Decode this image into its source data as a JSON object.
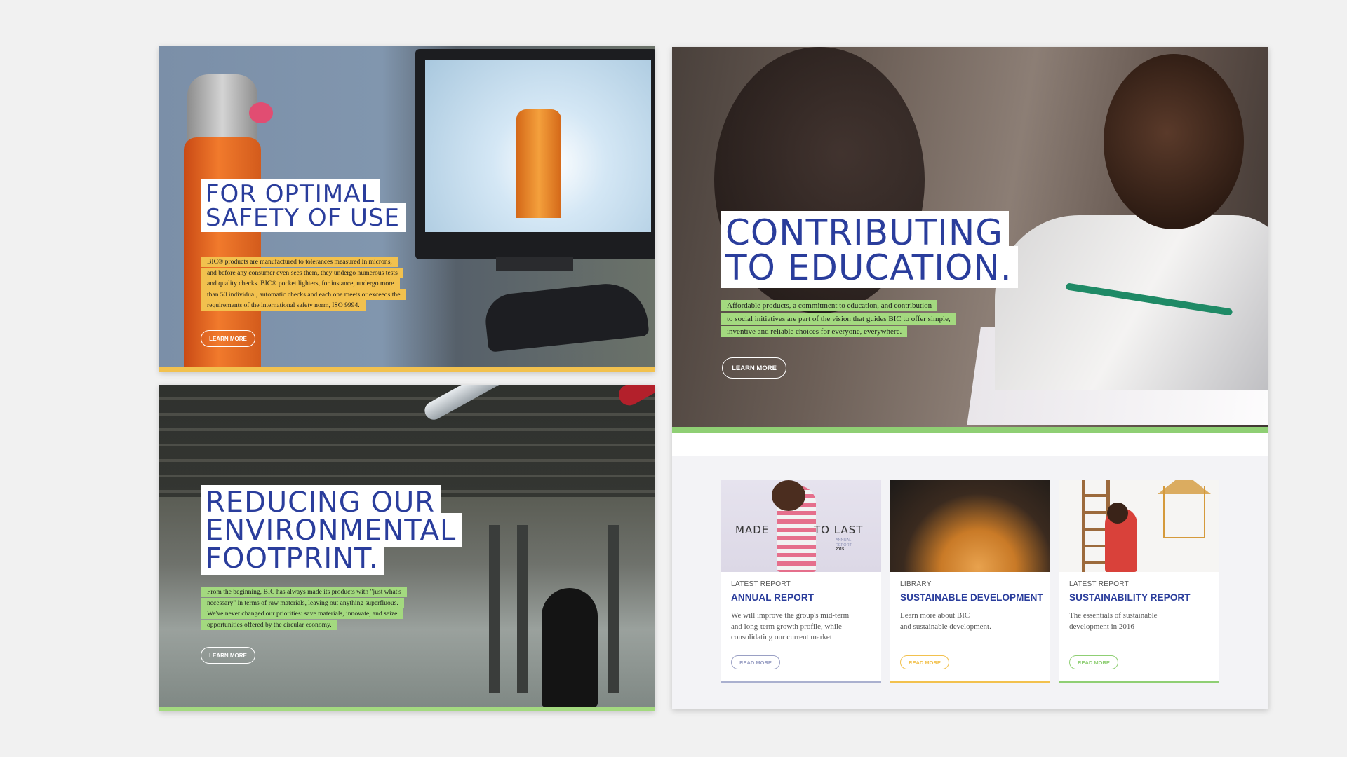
{
  "panels": {
    "safety": {
      "title_line1": "FOR OPTIMAL",
      "title_line2": "SAFETY OF USE",
      "desc_line1": "BIC® products are manufactured to tolerances measured in microns,",
      "desc_line2": "and before any consumer even sees them, they undergo numerous tests",
      "desc_line3": "and quality checks. BIC® pocket lighters, for instance, undergo more",
      "desc_line4": "than 50 individual, automatic checks and each one meets or exceeds the",
      "desc_line5": "requirements of the international safety norm, ISO 9994.",
      "button": "LEARN MORE",
      "accent": "#f2c14e"
    },
    "environment": {
      "title_line1": "REDUCING OUR",
      "title_line2": "ENVIRONMENTAL",
      "title_line3": "FOOTPRINT.",
      "desc_line1": "From the beginning, BIC has always made its products with \"just what's",
      "desc_line2": "necessary\" in terms of raw materials, leaving out anything superfluous.",
      "desc_line3": "We've never changed our priorities: save materials, innovate, and seize",
      "desc_line4": "opportunities offered by the circular economy.",
      "button": "LEARN MORE",
      "accent": "#a3d97f"
    },
    "education": {
      "title_line1": "CONTRIBUTING",
      "title_line2": "TO EDUCATION.",
      "desc_line1": "Affordable products, a commitment to education, and contribution",
      "desc_line2": "to social initiatives are part of the vision that guides BIC to offer simple,",
      "desc_line3": "inventive and reliable choices for everyone, everywhere.",
      "button": "LEARN MORE",
      "accent": "#8fcf74"
    }
  },
  "cards": [
    {
      "category": "LATEST REPORT",
      "title": "ANNUAL REPORT",
      "body_line1": "We will improve the group's mid-term",
      "body_line2": "and long-term growth profile, while",
      "body_line3": "consolidating our current market",
      "button": "READ MORE",
      "thumb_made": "MADE",
      "thumb_last": "TO LAST",
      "thumb_small_line1": "ANNUAL",
      "thumb_small_line2": "REPORT",
      "thumb_year": "2015",
      "accent": "#aab0cf"
    },
    {
      "category": "LIBRARY",
      "title": "SUSTAINABLE DEVELOPMENT",
      "body_line1": "Learn more about BIC",
      "body_line2": "and sustainable development.",
      "button": "READ MORE",
      "accent": "#f2c14e"
    },
    {
      "category": "LATEST REPORT",
      "title": "SUSTAINABILITY REPORT",
      "body_line1": "The essentials of sustainable",
      "body_line2": "development in 2016",
      "button": "READ MORE",
      "accent": "#8fcf74"
    }
  ],
  "colors": {
    "title_blue": "#2a3d9c",
    "background": "#f1f1f1",
    "yellow": "#f2c14e",
    "green": "#8fcf74"
  }
}
